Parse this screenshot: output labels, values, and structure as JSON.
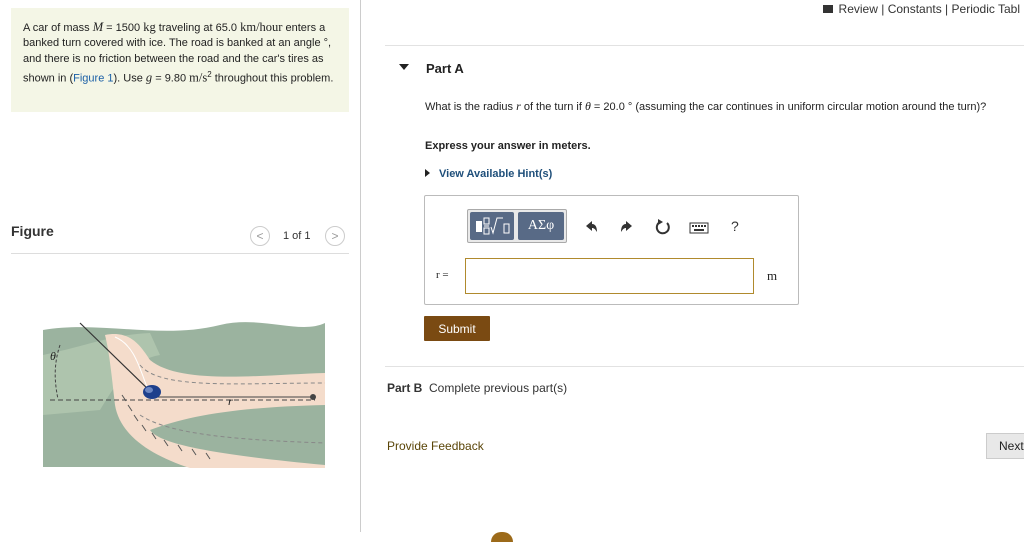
{
  "problem": {
    "text_1": "A car of mass ",
    "var_M": "M",
    "text_2": " = 1500 ",
    "unit_kg": "kg",
    "text_3": " traveling at 65.0 ",
    "unit_speed": "km/hour",
    "text_4": " enters a banked turn covered with ice. The road is banked at an angle °, and there is no friction between the road and the car's tires as shown in (",
    "figure_link": "Figure 1",
    "text_5": "). Use ",
    "var_g": "g",
    "text_6": " = 9.80 ",
    "unit_g": "m/s",
    "unit_g_exp": "2",
    "text_7": " throughout this problem."
  },
  "figure": {
    "label": "Figure",
    "pager": "1 of 1",
    "prev": "<",
    "next": ">",
    "theta": "θ",
    "r": "r"
  },
  "top_links": {
    "review": "Review",
    "sep1": " | ",
    "constants": "Constants",
    "sep2": " | ",
    "periodic": "Periodic Tabl"
  },
  "part_a": {
    "title": "Part A",
    "q_1": "What is the radius ",
    "q_var_r": "r",
    "q_2": " of the turn if ",
    "q_var_theta": "θ",
    "q_3": " = 20.0 ° (assuming the car continues in uniform circular motion around the turn)?",
    "express": "Express your answer in meters.",
    "hints": "View Available Hint(s)",
    "toolbar": {
      "greek": "ΑΣφ",
      "help": "?"
    },
    "answer_label": "r =",
    "answer_value": "",
    "unit": "m",
    "submit": "Submit"
  },
  "part_b": {
    "title": "Part B",
    "status": "Complete previous part(s)"
  },
  "footer": {
    "feedback": "Provide Feedback",
    "next": "Next"
  },
  "colors": {
    "problem_bg": "#f4f6e6",
    "submit_bg": "#7a4a12",
    "input_border": "#b08a2d",
    "toolbar_btn": "#586a86"
  }
}
